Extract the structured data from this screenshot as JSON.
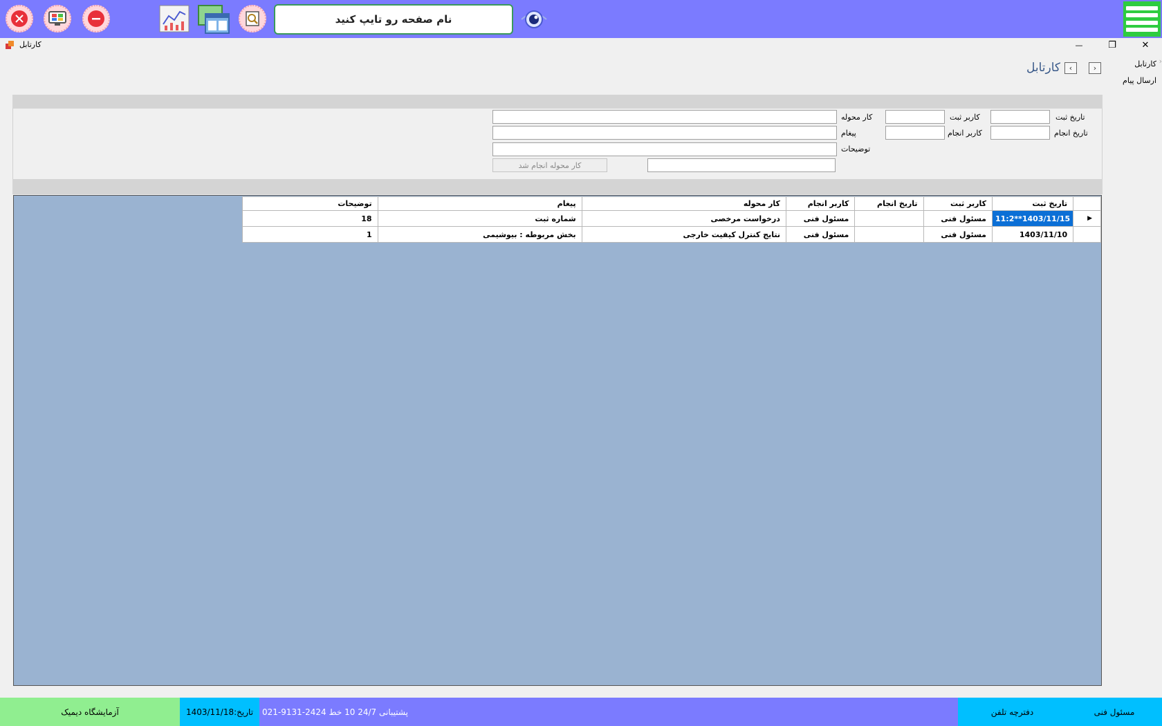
{
  "toolbar": {
    "search_placeholder": "نام صفحه رو تایپ کنید",
    "icons": [
      "close-icon",
      "monitor-icon",
      "minimize-icon",
      "chart-icon",
      "windows-icon",
      "search-doc-icon",
      "eye-icon",
      "menu-icon"
    ],
    "colors": {
      "bar": "#7b7bff",
      "menu": "#2ecc40",
      "search_border": "#3a9a5a"
    }
  },
  "window": {
    "title": "کارتابل",
    "minimize": "—",
    "restore": "❐",
    "close": "✕"
  },
  "nav": {
    "items": [
      {
        "label": "کارتابل"
      },
      {
        "label": "ارسال پیام"
      }
    ]
  },
  "page": {
    "heading": "کارتابل",
    "prev": "‹",
    "next": "›"
  },
  "filters": {
    "reg_date_label": "تاریخ ثبت",
    "reg_user_label": "کاربر ثبت",
    "task_label": "کار محوله",
    "done_date_label": "تاریخ انجام",
    "done_user_label": "کاربر انجام",
    "message_label": "پیغام",
    "notes_label": "توضیحات",
    "done_button": "کار محوله انجام شد"
  },
  "grid": {
    "columns": [
      "تاریخ ثبت",
      "کاربر ثبت",
      "تاریخ انجام",
      "کاربر انجام",
      "کار محوله",
      "پیغام",
      "توضیحات"
    ],
    "rows": [
      {
        "reg_date": "1403/11/15**11:2",
        "reg_user": "مسئول فنی",
        "done_date": "",
        "done_user": "مسئول فنی",
        "task": "درخواست مرخصی",
        "message": "شماره ثبت",
        "notes": "18"
      },
      {
        "reg_date": "1403/11/10",
        "reg_user": "مسئول فنی",
        "done_date": "",
        "done_user": "مسئول فنی",
        "task": "نتایج کنترل کیفیت خارجی",
        "message": "بخش مربوطه : بیوشیمی",
        "notes": "1"
      }
    ],
    "row_pointer": "▶",
    "colors": {
      "background": "#9ab3d1",
      "selection": "#0b6fd6"
    }
  },
  "status": {
    "user": "مسئول فنی",
    "phonebook": "دفترچه تلفن",
    "support": "پشتیبانی 24/7    10  خط  2424-9131-021",
    "date": "تاریخ:1403/11/18",
    "lab": "آزمایشگاه دیمیک",
    "colors": {
      "user": "#00bfff",
      "bar": "#7b7bff",
      "date": "#00bfff",
      "lab": "#90ee90"
    }
  }
}
